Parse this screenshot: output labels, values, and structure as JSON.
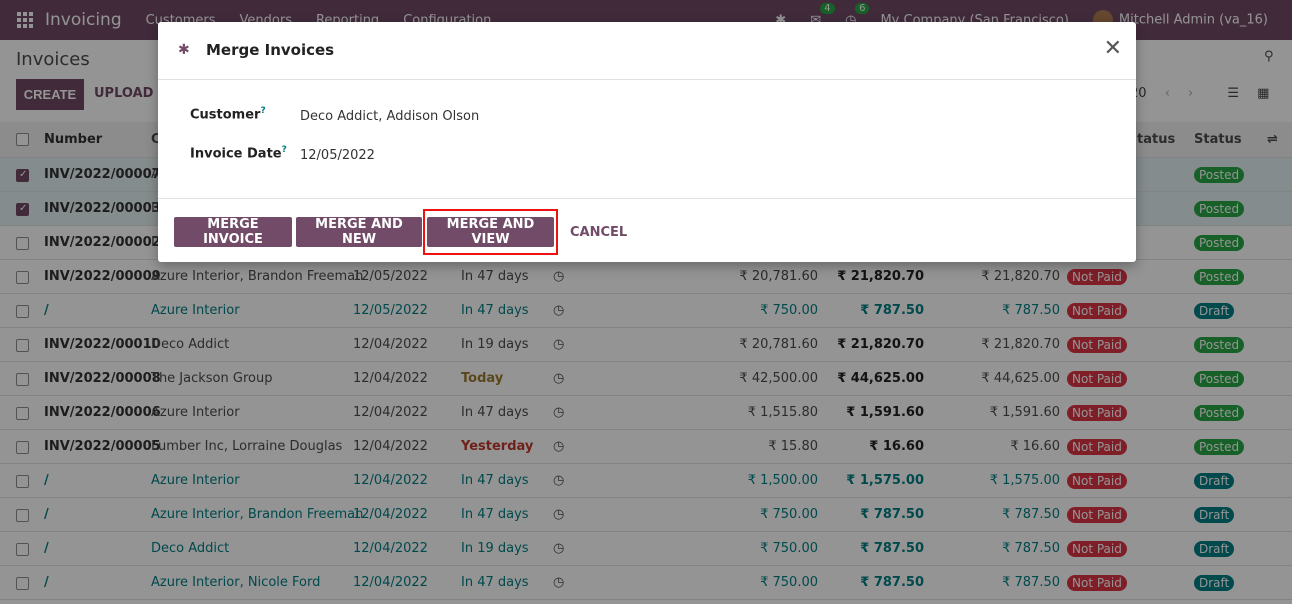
{
  "navbar": {
    "app_name": "Invoicing",
    "menu": [
      "Customers",
      "Vendors",
      "Reporting",
      "Configuration"
    ],
    "chat_count": "4",
    "activity_count": "6",
    "company": "My Company (San Francisco)",
    "user": "Mitchell Admin (va_16)"
  },
  "control_panel": {
    "title": "Invoices",
    "create_label": "CREATE",
    "upload_label": "UPLOAD",
    "pager": "20"
  },
  "table": {
    "headers": {
      "number": "Number",
      "partner": "C",
      "payment": "tatus",
      "status": "Status"
    },
    "rows": [
      {
        "number": "INV/2022/00007",
        "partner": "A",
        "date": "",
        "due": "",
        "untaxed": "",
        "total": "",
        "residual": "",
        "payment": "",
        "status": "Posted",
        "selected": true,
        "is_draft": false,
        "due_class": ""
      },
      {
        "number": "INV/2022/00003",
        "partner": "D",
        "date": "",
        "due": "",
        "untaxed": "",
        "total": "",
        "residual": "",
        "payment": "",
        "status": "Posted",
        "selected": true,
        "is_draft": false,
        "due_class": ""
      },
      {
        "number": "INV/2022/00002",
        "partner": "D",
        "date": "",
        "due": "",
        "untaxed": "",
        "total": "",
        "residual": "",
        "payment": "",
        "status": "Posted",
        "selected": false,
        "is_draft": false,
        "due_class": ""
      },
      {
        "number": "INV/2022/00009",
        "partner": "Azure Interior, Brandon Freeman",
        "date": "12/05/2022",
        "due": "In 47 days",
        "untaxed": "₹ 20,781.60",
        "total": "₹ 21,820.70",
        "residual": "₹ 21,820.70",
        "payment": "Not Paid",
        "status": "Posted",
        "selected": false,
        "is_draft": false,
        "due_class": ""
      },
      {
        "number": "/",
        "partner": "Azure Interior",
        "date": "12/05/2022",
        "due": "In 47 days",
        "untaxed": "₹ 750.00",
        "total": "₹ 787.50",
        "residual": "₹ 787.50",
        "payment": "Not Paid",
        "status": "Draft",
        "selected": false,
        "is_draft": true,
        "due_class": ""
      },
      {
        "number": "INV/2022/00010",
        "partner": "Deco Addict",
        "date": "12/04/2022",
        "due": "In 19 days",
        "untaxed": "₹ 20,781.60",
        "total": "₹ 21,820.70",
        "residual": "₹ 21,820.70",
        "payment": "Not Paid",
        "status": "Posted",
        "selected": false,
        "is_draft": false,
        "due_class": ""
      },
      {
        "number": "INV/2022/00008",
        "partner": "The Jackson Group",
        "date": "12/04/2022",
        "due": "Today",
        "untaxed": "₹ 42,500.00",
        "total": "₹ 44,625.00",
        "residual": "₹ 44,625.00",
        "payment": "Not Paid",
        "status": "Posted",
        "selected": false,
        "is_draft": false,
        "due_class": "today"
      },
      {
        "number": "INV/2022/00006",
        "partner": "Azure Interior",
        "date": "12/04/2022",
        "due": "In 47 days",
        "untaxed": "₹ 1,515.80",
        "total": "₹ 1,591.60",
        "residual": "₹ 1,591.60",
        "payment": "Not Paid",
        "status": "Posted",
        "selected": false,
        "is_draft": false,
        "due_class": ""
      },
      {
        "number": "INV/2022/00005",
        "partner": "Lumber Inc, Lorraine Douglas",
        "date": "12/04/2022",
        "due": "Yesterday",
        "untaxed": "₹ 15.80",
        "total": "₹ 16.60",
        "residual": "₹ 16.60",
        "payment": "Not Paid",
        "status": "Posted",
        "selected": false,
        "is_draft": false,
        "due_class": "yest"
      },
      {
        "number": "/",
        "partner": "Azure Interior",
        "date": "12/04/2022",
        "due": "In 47 days",
        "untaxed": "₹ 1,500.00",
        "total": "₹ 1,575.00",
        "residual": "₹ 1,575.00",
        "payment": "Not Paid",
        "status": "Draft",
        "selected": false,
        "is_draft": true,
        "due_class": ""
      },
      {
        "number": "/",
        "partner": "Azure Interior, Brandon Freeman",
        "date": "12/04/2022",
        "due": "In 47 days",
        "untaxed": "₹ 750.00",
        "total": "₹ 787.50",
        "residual": "₹ 787.50",
        "payment": "Not Paid",
        "status": "Draft",
        "selected": false,
        "is_draft": true,
        "due_class": ""
      },
      {
        "number": "/",
        "partner": "Deco Addict",
        "date": "12/04/2022",
        "due": "In 19 days",
        "untaxed": "₹ 750.00",
        "total": "₹ 787.50",
        "residual": "₹ 787.50",
        "payment": "Not Paid",
        "status": "Draft",
        "selected": false,
        "is_draft": true,
        "due_class": ""
      },
      {
        "number": "/",
        "partner": "Azure Interior, Nicole Ford",
        "date": "12/04/2022",
        "due": "In 47 days",
        "untaxed": "₹ 750.00",
        "total": "₹ 787.50",
        "residual": "₹ 787.50",
        "payment": "Not Paid",
        "status": "Draft",
        "selected": false,
        "is_draft": true,
        "due_class": ""
      }
    ]
  },
  "modal": {
    "title": "Merge Invoices",
    "customer_label": "Customer",
    "customer_value": "Deco Addict, Addison Olson",
    "date_label": "Invoice Date",
    "date_value": "12/05/2022",
    "help_mark": "?",
    "buttons": {
      "merge_invoice": "MERGE INVOICE",
      "merge_and_new": "MERGE AND NEW",
      "merge_and_view": "MERGE AND VIEW",
      "cancel": "CANCEL"
    },
    "highlight_color": "#ee1111"
  },
  "colors": {
    "brand": "#714b67",
    "posted": "#28a745",
    "draft": "#017e84",
    "not_paid": "#dc3545"
  }
}
